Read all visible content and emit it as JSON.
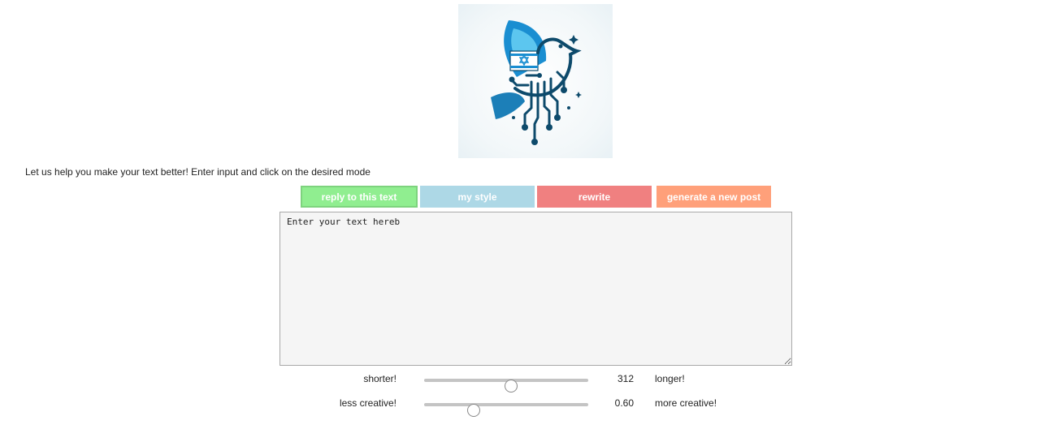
{
  "intro_text": "Let us help you make your text better! Enter input and click on the desired mode",
  "modes": {
    "reply": "reply to this text",
    "my_style": "my style",
    "rewrite": "rewrite",
    "generate": "generate a new post"
  },
  "mode_colors": {
    "reply": "#90ee90",
    "my_style": "#add8e6",
    "rewrite": "#f08080",
    "generate": "#ffa07a"
  },
  "editor": {
    "value": "Enter your text hereb"
  },
  "length_slider": {
    "left_label": "shorter!",
    "right_label": "longer!",
    "value": "312",
    "fraction": 0.53
  },
  "creativity_slider": {
    "left_label": "less creative!",
    "right_label": "more creative!",
    "value": "0.60",
    "fraction": 0.3
  },
  "logo_icon": "dove-circuit-star-of-david-icon"
}
